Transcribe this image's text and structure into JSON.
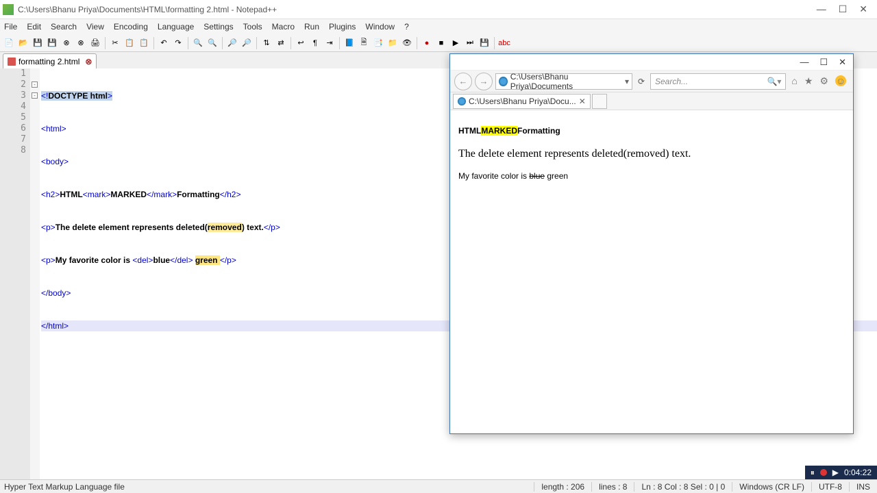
{
  "window": {
    "title": "C:\\Users\\Bhanu Priya\\Documents\\HTML\\formatting 2.html - Notepad++"
  },
  "menu": [
    "File",
    "Edit",
    "Search",
    "View",
    "Encoding",
    "Language",
    "Settings",
    "Tools",
    "Macro",
    "Run",
    "Plugins",
    "Window",
    "?"
  ],
  "tab": {
    "label": "formatting 2.html"
  },
  "code": {
    "lines": [
      "1",
      "2",
      "3",
      "4",
      "5",
      "6",
      "7",
      "8"
    ],
    "l1_a": "<!",
    "l1_b": "DOCTYPE html",
    "l1_c": ">",
    "l2": "<html>",
    "l3": "<body>",
    "l4_a": "<h2>",
    "l4_b": "HTML",
    "l4_c": "<mark>",
    "l4_d": "MARKED",
    "l4_e": "</mark>",
    "l4_f": "Formatting",
    "l4_g": "</h2>",
    "l5_a": "<p>",
    "l5_b": "The delete element represents deleted(",
    "l5_c": "removed",
    "l5_d": ") text.",
    "l5_e": "</p>",
    "l6_a": "<p>",
    "l6_b": "My favorite color is ",
    "l6_c": "<del>",
    "l6_d": "blue",
    "l6_e": "</del>",
    "l6_f": " ",
    "l6_g": "green ",
    "l6_h": "</p>",
    "l7": "</body>",
    "l8": "</html>"
  },
  "browser": {
    "address": "C:\\Users\\Bhanu Priya\\Documents",
    "search_placeholder": "Search...",
    "tab": "C:\\Users\\Bhanu Priya\\Docu...",
    "page": {
      "h2_a": "HTML",
      "h2_b": "MARKED",
      "h2_c": "Formatting",
      "p1": "The delete element represents deleted(removed) text.",
      "p2_a": "My favorite color is ",
      "p2_b": "blue",
      "p2_c": " green"
    }
  },
  "status": {
    "left": "Hyper Text Markup Language file",
    "length": "length : 206",
    "lines": "lines : 8",
    "pos": "Ln : 8    Col : 8    Sel : 0 | 0",
    "eol": "Windows (CR LF)",
    "enc": "UTF-8",
    "ins": "INS"
  },
  "tray": {
    "time": "0:04:22"
  }
}
